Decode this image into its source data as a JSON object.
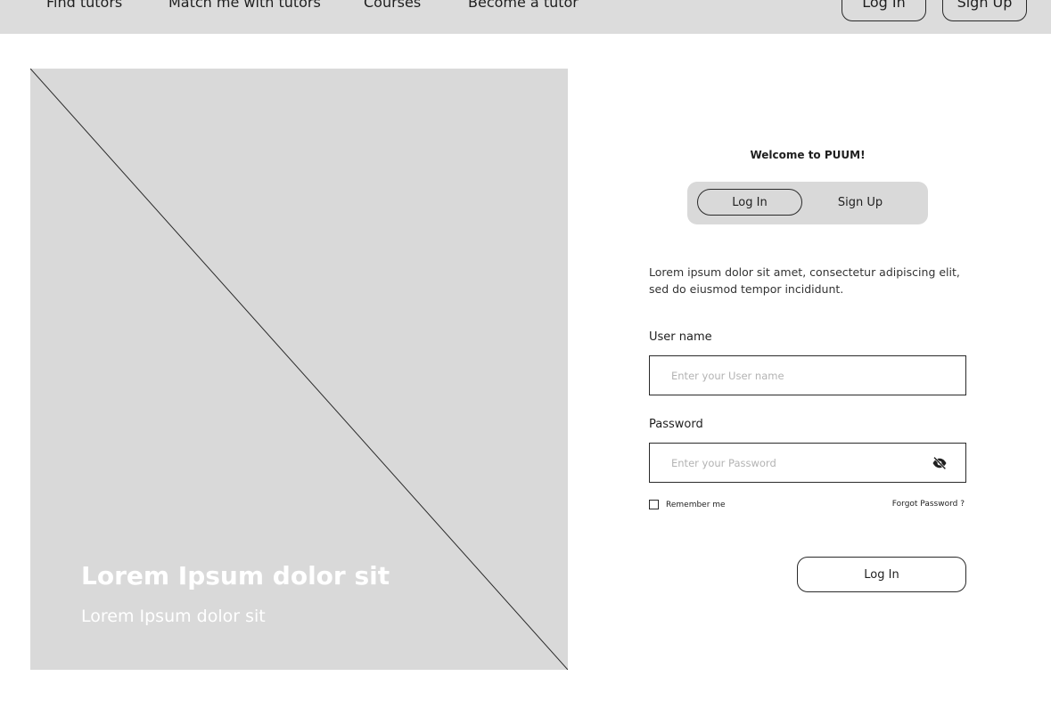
{
  "nav": {
    "links": [
      "Find tutors",
      "Match me with tutors",
      "Courses",
      "Become a tutor"
    ],
    "login_label": "Log In",
    "signup_label": "Sign Up"
  },
  "hero": {
    "title": "Lorem Ipsum dolor sit",
    "subtitle": "Lorem Ipsum dolor sit"
  },
  "form": {
    "welcome": "Welcome to PUUM!",
    "toggle": {
      "login": "Log In",
      "signup": "Sign Up",
      "active": "Log In"
    },
    "description": "Lorem ipsum dolor sit amet, consectetur adipiscing elit, sed do eiusmod tempor incididunt.",
    "username": {
      "label": "User name",
      "placeholder": "Enter your User name",
      "value": ""
    },
    "password": {
      "label": "Password",
      "placeholder": "Enter your Password",
      "value": "",
      "icon": "eye-slash-icon"
    },
    "remember_label": "Remember me",
    "remember_checked": false,
    "forgot_label": "Forgot Password ?",
    "submit_label": "Log In"
  },
  "colors": {
    "nav_background": "#dcdcdc",
    "placeholder_block": "#d9d9d9",
    "border": "#2a2a2a"
  }
}
